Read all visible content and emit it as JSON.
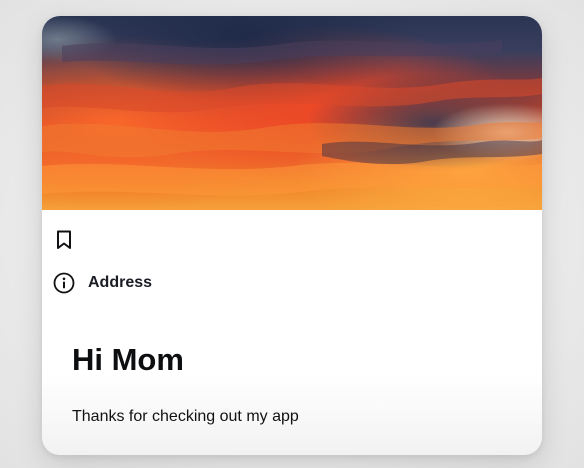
{
  "card": {
    "hero_image": "sunset-clouds",
    "bookmark_icon": "bookmark-icon",
    "info_icon": "info-icon",
    "address_label": "Address",
    "title": "Hi Mom",
    "subtitle": "Thanks for checking out my app"
  },
  "colors": {
    "text_primary": "#0d0e10",
    "label_text": "#1a1d24",
    "card_background": "#ffffff",
    "page_background": "#ececec"
  }
}
